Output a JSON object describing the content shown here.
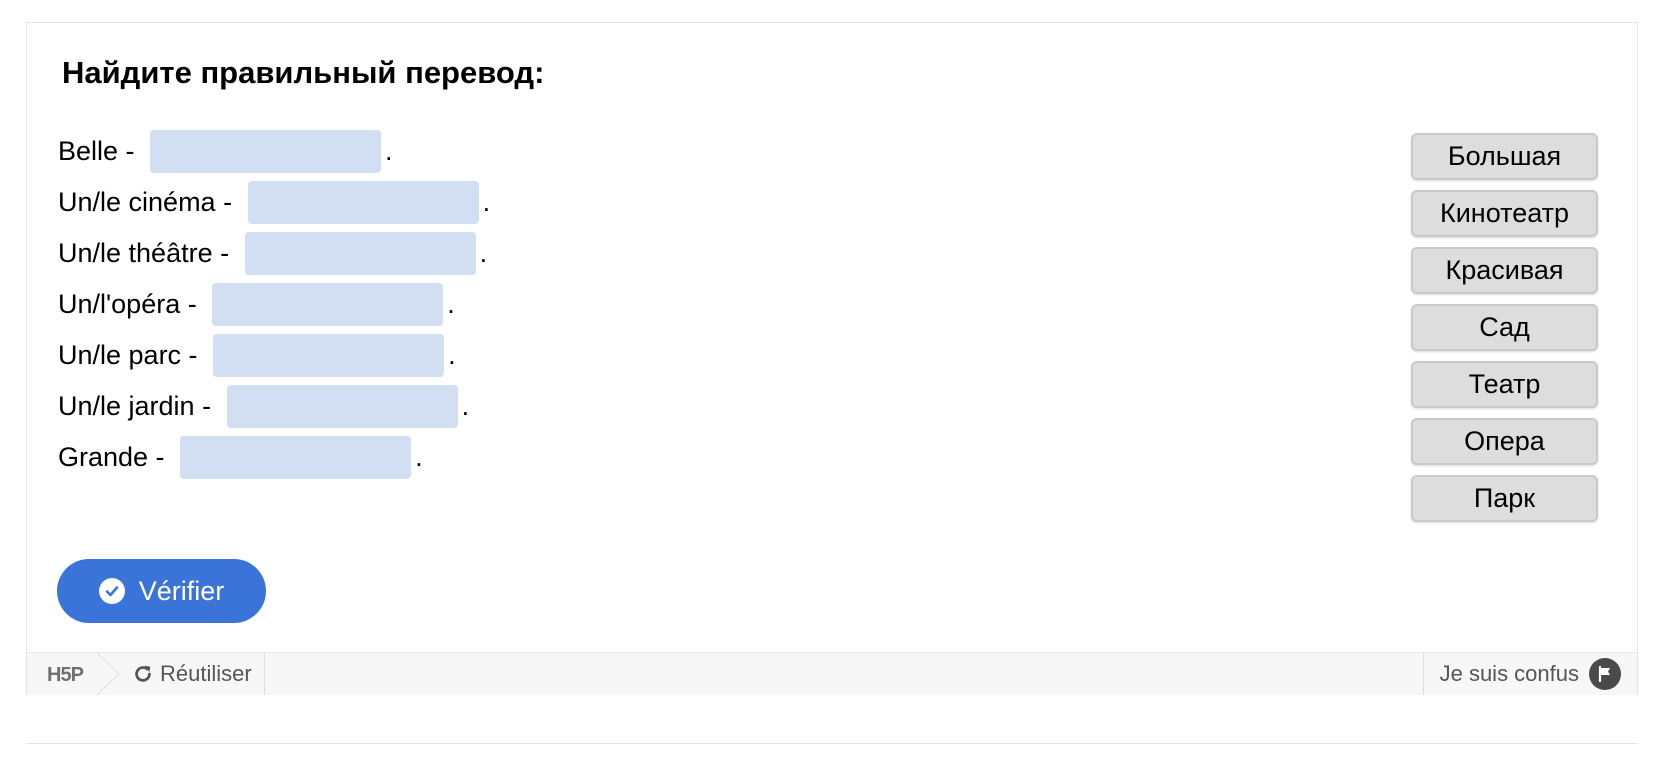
{
  "title": "Найдите правильный перевод:",
  "rows": [
    {
      "label": "Belle - ",
      "dot": "."
    },
    {
      "label": "Un/le cinéma - ",
      "dot": "."
    },
    {
      "label": "Un/le théâtre - ",
      "dot": "."
    },
    {
      "label": "Un/l'opéra - ",
      "dot": "."
    },
    {
      "label": "Un/le parc - ",
      "dot": "."
    },
    {
      "label": "Un/le jardin - ",
      "dot": "."
    },
    {
      "label": "Grande - ",
      "dot": "."
    }
  ],
  "words": [
    "Большая",
    "Кинотеатр",
    "Красивая",
    "Сад",
    "Театр",
    "Опера",
    "Парк"
  ],
  "check_button": {
    "label": "Vérifier",
    "icon": "check-circle-icon"
  },
  "footer": {
    "logo": "H5P",
    "reuse_label": "Réutiliser",
    "reuse_icon": "refresh-icon",
    "confused_label": "Je suis confus",
    "confused_icon": "flag-icon"
  },
  "colors": {
    "accent": "#3b74d9",
    "dropzone": "#d2def2",
    "word_bg": "#dddddd"
  }
}
